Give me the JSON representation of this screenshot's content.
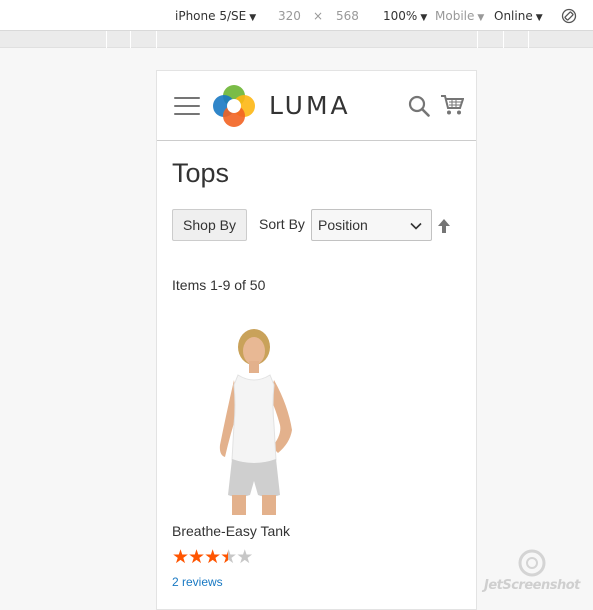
{
  "devtools": {
    "device": "iPhone 5/SE",
    "width": "320",
    "times": "×",
    "height": "568",
    "zoom": "100%",
    "mode": "Mobile",
    "network": "Online",
    "caret": "▼"
  },
  "header": {
    "logo_text": "LUMA"
  },
  "page": {
    "title": "Tops"
  },
  "toolbar": {
    "shop_by": "Shop By",
    "sort_label": "Sort By",
    "sort_value": "Position",
    "amount": "Items 1-9 of 50"
  },
  "product": {
    "name": "Breathe-Easy Tank",
    "rating_stars": 3.5,
    "rating_max": 5,
    "reviews": "2 reviews"
  },
  "watermark": {
    "text": "JetScreenshot"
  },
  "colors": {
    "star_on": "#ff5501",
    "star_off": "#c7c7c7",
    "link": "#1979c3",
    "logo_orange": "#f26322",
    "logo_green": "#6bb533",
    "logo_blue": "#1979c3",
    "logo_yellow": "#fdb714"
  }
}
